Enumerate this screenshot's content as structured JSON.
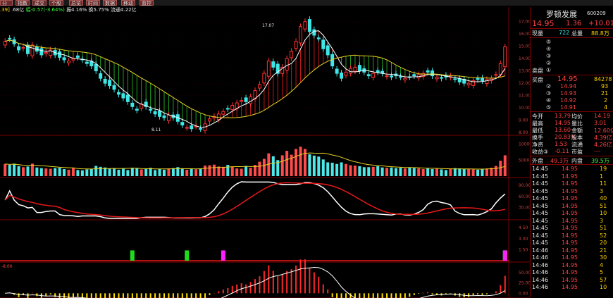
{
  "toolbar": {
    "buttons": [
      "分析",
      "指数",
      "成交",
      "个股",
      "总览",
      "时间",
      "数据",
      "移动",
      "监控"
    ]
  },
  "info": {
    "a": ".39]",
    "b": ".68亿",
    "c": "幅-0.57(-3.64%)",
    "d": "振4.16%",
    "e": "换5.75%",
    "f": "流通4.22亿"
  },
  "panel": {
    "name": "罗顿发展",
    "code": "600209",
    "price": "14.95",
    "change": "1.36",
    "pct": "+10.01",
    "xianliang_label": "现量",
    "xianliang": "722",
    "zongliang_label": "总量",
    "zongliang": "88.8万",
    "sell_nums": [
      "⑤",
      "④",
      "③",
      "②",
      "①"
    ],
    "sell_label": "卖盘",
    "buy_label": "买盘",
    "buy_price": "14.95",
    "buy_vol": "84278",
    "buy_rows": [
      {
        "n": "②",
        "p": "14.94",
        "v": "93"
      },
      {
        "n": "③",
        "p": "14.93",
        "v": "21"
      },
      {
        "n": "④",
        "p": "14.92",
        "v": "2"
      },
      {
        "n": "⑤",
        "p": "14.91",
        "v": "4"
      }
    ],
    "stats": [
      {
        "l1": "今开",
        "v1": "13.79",
        "l2": "均价",
        "v2": "14.19"
      },
      {
        "l1": "最高",
        "v1": "14.95",
        "l2": "量比",
        "v2": "3.01"
      },
      {
        "l1": "最低",
        "v1": "13.60",
        "l2": "金额",
        "v2": "12.60亿"
      },
      {
        "l1": "换手",
        "v1": "20.83%",
        "l2": "股本",
        "v2": "4.39亿"
      },
      {
        "l1": "净资",
        "v1": "1.53",
        "l2": "流通",
        "v2": "4.26亿"
      },
      {
        "l1": "收益③",
        "v1": "-0.11",
        "l2": "市盈",
        "v2": "---"
      }
    ],
    "outer_label": "外盘",
    "outer": "49.3万",
    "inner_label": "内盘",
    "inner": "39.5万",
    "ticks": [
      {
        "t": "14:45",
        "p": "14.95",
        "v": "19"
      },
      {
        "t": "14:45",
        "p": "14.95",
        "v": "1"
      },
      {
        "t": "14:45",
        "p": "14.95",
        "v": "11"
      },
      {
        "t": "14:45",
        "p": "14.95",
        "v": "3"
      },
      {
        "t": "14:45",
        "p": "14.95",
        "v": "40"
      },
      {
        "t": "14:45",
        "p": "14.95",
        "v": "51"
      },
      {
        "t": "14:45",
        "p": "14.95",
        "v": "10"
      },
      {
        "t": "14:45",
        "p": "14.95",
        "v": "3"
      },
      {
        "t": "14:45",
        "p": "14.95",
        "v": "51"
      },
      {
        "t": "14:45",
        "p": "14.95",
        "v": "52"
      },
      {
        "t": "14:45",
        "p": "14.95",
        "v": "20"
      },
      {
        "t": "14:46",
        "p": "14.95",
        "v": "21"
      },
      {
        "t": "14:46",
        "p": "14.95",
        "v": "30"
      },
      {
        "t": "14:46",
        "p": "14.95",
        "v": "4"
      },
      {
        "t": "14:46",
        "p": "14.95",
        "v": "5"
      },
      {
        "t": "14:46",
        "p": "14.95",
        "v": "57"
      },
      {
        "t": "14:46",
        "p": "14.95",
        "v": "10"
      }
    ]
  },
  "chart_data": {
    "type": "candlestick",
    "price_axis": {
      "ticks": [
        "17.00",
        "16.00",
        "15.00",
        "14.00",
        "13.00",
        "12.00",
        "11.00",
        "10.00",
        "9.00",
        "8.00"
      ],
      "ylim": [
        8,
        17.5
      ]
    },
    "annotations": {
      "high": "17.07",
      "low": "8.11"
    },
    "volume_axis": {
      "ticks": [
        "10000",
        "5000"
      ]
    },
    "kdj_axis": {
      "ticks": [
        "90.00",
        "60.00",
        "30.00"
      ]
    },
    "sig_axis": {
      "ticks": [
        "4.50",
        "3.00",
        "1.50"
      ]
    },
    "osc_axis": {
      "ticks": [
        "50.00",
        "25.00",
        "0.00"
      ],
      "min_label": "-8.00"
    },
    "closes": [
      15.4,
      15.6,
      15.2,
      14.7,
      14.9,
      14.4,
      15.1,
      14.6,
      14.3,
      14.5,
      14.7,
      14.3,
      14.1,
      13.9,
      13.8,
      14.0,
      14.1,
      13.9,
      13.6,
      13.4,
      13.0,
      12.4,
      12.0,
      11.8,
      11.5,
      11.1,
      10.8,
      10.5,
      10.1,
      9.8,
      10.3,
      10.1,
      9.8,
      9.5,
      9.3,
      9.2,
      9.4,
      9.2,
      8.9,
      8.6,
      8.4,
      8.3,
      8.5,
      8.3,
      8.7,
      9.1,
      9.3,
      9.5,
      9.7,
      9.9,
      10.2,
      10.4,
      10.6,
      10.5,
      10.9,
      11.4,
      11.9,
      12.8,
      13.8,
      13.3,
      12.8,
      13.3,
      14.0,
      14.6,
      15.4,
      16.6,
      17.0,
      16.2,
      15.9,
      15.6,
      14.8,
      14.3,
      13.4,
      12.8,
      12.4,
      12.9,
      13.2,
      13.3,
      13.0,
      12.9,
      12.6,
      12.8,
      12.9,
      12.8,
      12.6,
      12.5,
      12.6,
      12.5,
      12.4,
      12.5,
      12.6,
      12.7,
      12.8,
      12.9,
      12.6,
      12.5,
      12.4,
      12.5,
      12.6,
      12.3,
      12.1,
      12.0,
      12.0,
      12.2,
      12.3,
      12.2,
      12.3,
      12.4,
      12.7,
      13.59,
      14.95
    ],
    "volumes": [
      3800,
      3500,
      3900,
      3100,
      2800,
      3000,
      3900,
      2700,
      2500,
      2400,
      2300,
      2500,
      2600,
      2200,
      2000,
      2600,
      1900,
      1800,
      2100,
      2300,
      3200,
      2900,
      2700,
      2300,
      2400,
      2000,
      2300,
      1900,
      2600,
      2500,
      2100,
      2300,
      2600,
      1900,
      2300,
      2000,
      2400,
      2500,
      2800,
      2400,
      2000,
      2200,
      2100,
      2400,
      3300,
      3400,
      3600,
      3000,
      2900,
      3500,
      3000,
      2400,
      2300,
      3200,
      2600,
      3500,
      4500,
      5400,
      7100,
      6200,
      5000,
      6500,
      7900,
      6700,
      8500,
      9200,
      8500,
      6800,
      6400,
      6100,
      5200,
      4300,
      4200,
      3800,
      4300,
      3800,
      3400,
      3300,
      3100,
      2800,
      2800,
      2900,
      3100,
      2700,
      2600,
      2700,
      2500,
      2600,
      2400,
      2600,
      2500,
      2400,
      2200,
      2400,
      2200,
      2300,
      2100,
      1900,
      2200,
      2500,
      2400,
      2200,
      2300,
      2100,
      2000,
      2300,
      2400,
      2600,
      3200,
      4800,
      6500
    ]
  }
}
